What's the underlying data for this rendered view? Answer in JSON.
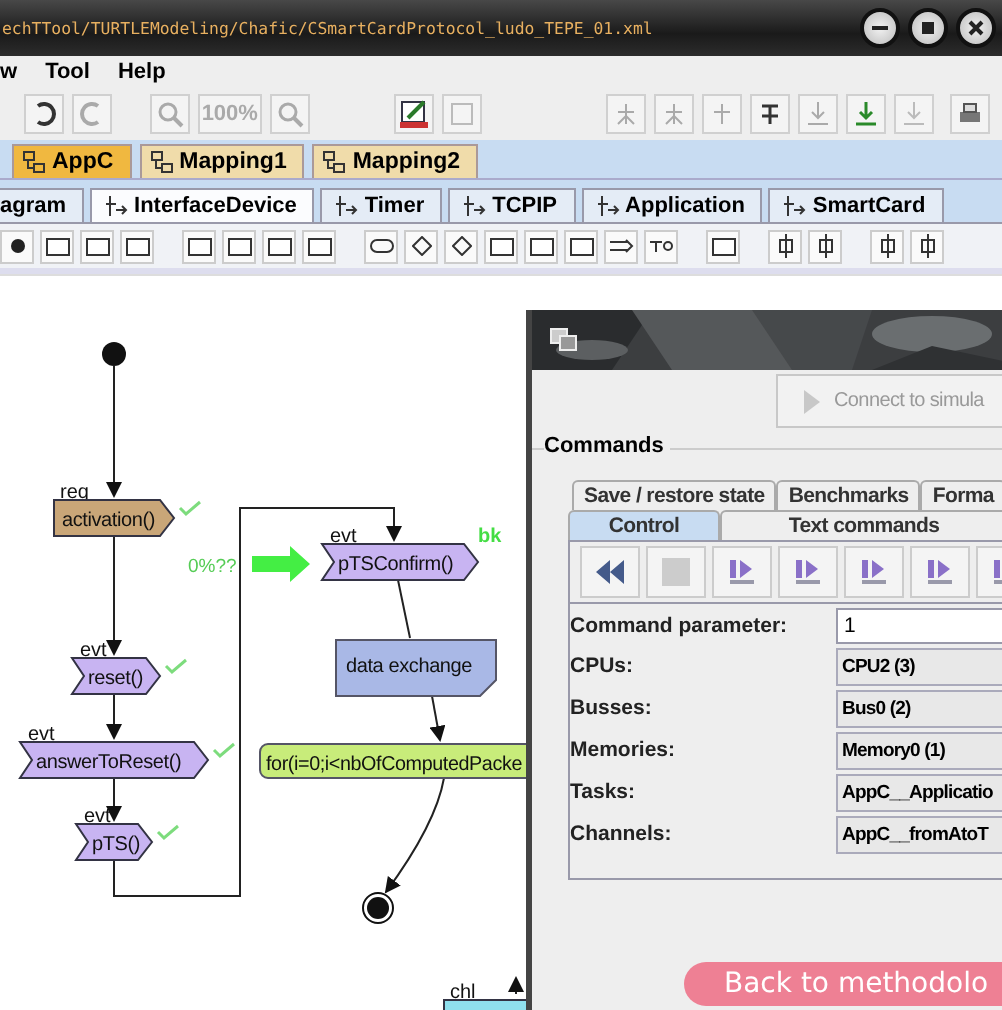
{
  "window": {
    "title": "echTTool/TURTLEModeling/Chafic/CSmartCardProtocol_ludo_TEPE_01.xml"
  },
  "menu": [
    "w",
    "Tool",
    "Help"
  ],
  "toolbar": {
    "zoom": "100%"
  },
  "diagram_tabs": [
    {
      "label": "AppC",
      "selected": true
    },
    {
      "label": "Mapping1",
      "selected": false
    },
    {
      "label": "Mapping2",
      "selected": false
    }
  ],
  "sub_tabs": [
    {
      "label": "agram",
      "selected": false
    },
    {
      "label": "InterfaceDevice",
      "selected": true
    },
    {
      "label": "Timer",
      "selected": false
    },
    {
      "label": "TCPIP",
      "selected": false
    },
    {
      "label": "Application",
      "selected": false
    },
    {
      "label": "SmartCard",
      "selected": false
    }
  ],
  "diagram": {
    "progress": "0%??",
    "nodes": [
      {
        "kind": "start"
      },
      {
        "kind": "send",
        "stereotype": "req",
        "label": "activation()",
        "checked": true
      },
      {
        "kind": "event",
        "stereotype": "evt",
        "label": "reset()",
        "checked": true
      },
      {
        "kind": "event",
        "stereotype": "evt",
        "label": "answerToReset()",
        "checked": true
      },
      {
        "kind": "event",
        "stereotype": "evt",
        "label": "pTS()",
        "checked": true
      },
      {
        "kind": "event",
        "stereotype": "evt",
        "label": "pTSConfirm()",
        "checked": false,
        "breakpoint": "bk"
      },
      {
        "kind": "note",
        "label": "data exchange"
      },
      {
        "kind": "loop",
        "label": "for(i=0;i<nbOfComputedPacke"
      },
      {
        "kind": "stop"
      },
      {
        "kind": "channel",
        "stereotype": "chl"
      }
    ]
  },
  "simulation": {
    "connect_button": "Connect to simula",
    "commands": {
      "title": "Commands",
      "tabs_back": [
        {
          "label": "Save / restore state",
          "selected": false
        },
        {
          "label": "Benchmarks",
          "selected": false
        },
        {
          "label": "Forma",
          "selected": false
        }
      ],
      "tabs_front": [
        {
          "label": "Control",
          "selected": true
        },
        {
          "label": "Text commands",
          "selected": false
        }
      ],
      "fields": [
        {
          "label": "Command parameter:",
          "value": "1",
          "kind": "input"
        },
        {
          "label": "CPUs:",
          "value": "CPU2 (3)",
          "kind": "select"
        },
        {
          "label": "Busses:",
          "value": "Bus0 (2)",
          "kind": "select"
        },
        {
          "label": "Memories:",
          "value": "Memory0 (1)",
          "kind": "select"
        },
        {
          "label": "Tasks:",
          "value": "AppC__Applicatio",
          "kind": "select"
        },
        {
          "label": "Channels:",
          "value": "AppC__fromAtoT",
          "kind": "select"
        }
      ]
    }
  },
  "overlay_link": "Back to methodolo"
}
